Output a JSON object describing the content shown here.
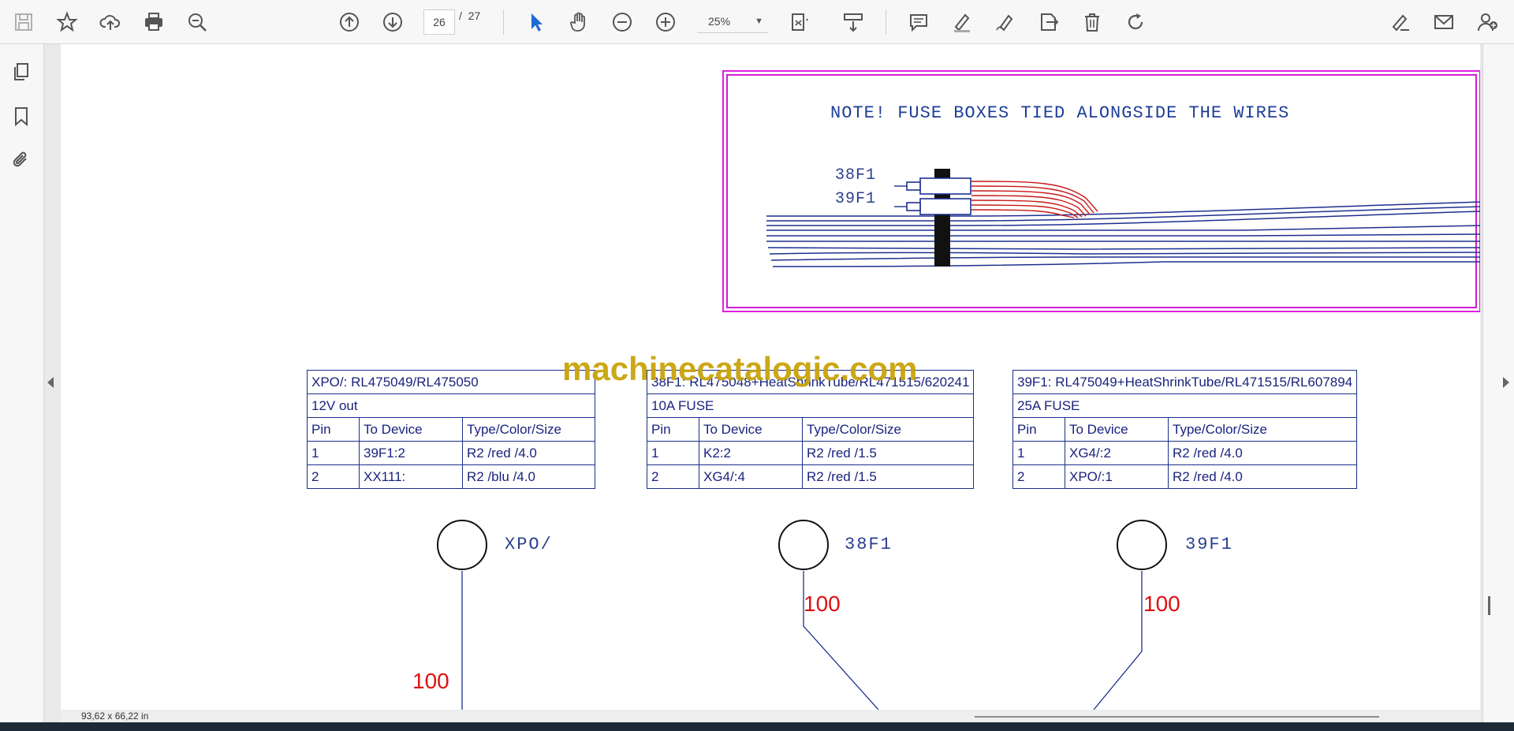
{
  "toolbar": {
    "page_current": "26",
    "page_separator": "/",
    "page_total": "27",
    "zoom": "25%",
    "icons": [
      "save-icon",
      "bookmark-star-icon",
      "cloud-upload-icon",
      "print-icon",
      "zoom-search-icon",
      "page-up-icon",
      "page-down-icon",
      "select-cursor-icon",
      "hand-pan-icon",
      "zoom-out-icon",
      "zoom-in-icon",
      "fit-page-icon",
      "scroll-mode-icon",
      "comment-icon",
      "highlight-pen-icon",
      "draw-sign-icon",
      "export-icon",
      "delete-icon",
      "rotate-icon",
      "fill-sign-icon",
      "email-icon",
      "add-user-icon"
    ]
  },
  "document": {
    "note": "NOTE! FUSE BOXES TIED ALONGSIDE THE WIRES",
    "fuse_labels": [
      "38F1",
      "39F1"
    ],
    "watermark": "machinecatalogic.com",
    "tables": [
      {
        "title": "XPO/: RL475049/RL475050",
        "subtitle": "12V out",
        "headers": [
          "Pin",
          "To Device",
          "Type/Color/Size"
        ],
        "rows": [
          [
            "1",
            "39F1:2",
            "R2 /red /4.0"
          ],
          [
            "2",
            "XX111:",
            "R2 /blu /4.0"
          ]
        ]
      },
      {
        "title": "38F1: RL475048+HeatShrinkTube/RL471515/620241",
        "subtitle": "10A FUSE",
        "headers": [
          "Pin",
          "To Device",
          "Type/Color/Size"
        ],
        "rows": [
          [
            "1",
            "K2:2",
            "R2 /red /1.5"
          ],
          [
            "2",
            "XG4/:4",
            "R2 /red /1.5"
          ]
        ]
      },
      {
        "title": "39F1: RL475049+HeatShrinkTube/RL471515/RL607894",
        "subtitle": "25A FUSE",
        "headers": [
          "Pin",
          "To Device",
          "Type/Color/Size"
        ],
        "rows": [
          [
            "1",
            "XG4/:2",
            "R2 /red /4.0"
          ],
          [
            "2",
            "XPO/:1",
            "R2 /red /4.0"
          ]
        ]
      }
    ],
    "symbols": [
      "XPO/",
      "38F1",
      "39F1"
    ],
    "wire_numbers": [
      "100",
      "100",
      "100"
    ]
  },
  "status": {
    "dimensions": "93,62 x 66,22 in"
  },
  "colors": {
    "frame": "#e01fe0",
    "wire_blue": "#1e2f8f",
    "wire_red": "#c81818",
    "table_text": "#1a237e",
    "watermark": "#c9a40b",
    "wire_number": "#e01010"
  }
}
